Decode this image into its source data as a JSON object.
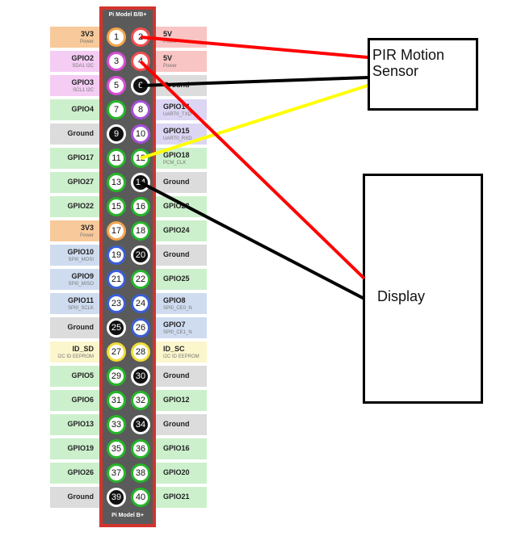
{
  "header": {
    "title": "Pi Model B/B+"
  },
  "footer": {
    "title": "Pi Model B+"
  },
  "colors": {
    "power": "#f4a44d",
    "power5v": "#f24e4e",
    "ground": "#111111",
    "gpio": "#27b52a",
    "i2c": "#d64fd6",
    "uart": "#a64fd6",
    "spi": "#3a5fd6",
    "eeprom": "#f0dd3a"
  },
  "rows": [
    {
      "left": {
        "pin": "1",
        "type": "power",
        "label": "3V3",
        "sub": "Power"
      },
      "right": {
        "pin": "2",
        "type": "power5v",
        "label": "5V",
        "sub": "Power"
      }
    },
    {
      "left": {
        "pin": "3",
        "type": "i2c",
        "label": "GPIO2",
        "sub": "SDA1 I2C"
      },
      "right": {
        "pin": "4",
        "type": "power5v",
        "label": "5V",
        "sub": "Power"
      }
    },
    {
      "left": {
        "pin": "5",
        "type": "i2c",
        "label": "GPIO3",
        "sub": "SCL1 I2C"
      },
      "right": {
        "pin": "6",
        "type": "ground",
        "label": "Ground",
        "sub": ""
      }
    },
    {
      "left": {
        "pin": "7",
        "type": "gpio",
        "label": "GPIO4",
        "sub": ""
      },
      "right": {
        "pin": "8",
        "type": "uart",
        "label": "GPIO14",
        "sub": "UART0_TXD"
      }
    },
    {
      "left": {
        "pin": "9",
        "type": "ground",
        "label": "Ground",
        "sub": ""
      },
      "right": {
        "pin": "10",
        "type": "uart",
        "label": "GPIO15",
        "sub": "UART0_RXD"
      }
    },
    {
      "left": {
        "pin": "11",
        "type": "gpio",
        "label": "GPIO17",
        "sub": ""
      },
      "right": {
        "pin": "12",
        "type": "gpio",
        "label": "GPIO18",
        "sub": "PCM_CLK"
      }
    },
    {
      "left": {
        "pin": "13",
        "type": "gpio",
        "label": "GPIO27",
        "sub": ""
      },
      "right": {
        "pin": "14",
        "type": "ground",
        "label": "Ground",
        "sub": ""
      }
    },
    {
      "left": {
        "pin": "15",
        "type": "gpio",
        "label": "GPIO22",
        "sub": ""
      },
      "right": {
        "pin": "16",
        "type": "gpio",
        "label": "GPIO23",
        "sub": ""
      }
    },
    {
      "left": {
        "pin": "17",
        "type": "power",
        "label": "3V3",
        "sub": "Power"
      },
      "right": {
        "pin": "18",
        "type": "gpio",
        "label": "GPIO24",
        "sub": ""
      }
    },
    {
      "left": {
        "pin": "19",
        "type": "spi",
        "label": "GPIO10",
        "sub": "SPI0_MOSI"
      },
      "right": {
        "pin": "20",
        "type": "ground",
        "label": "Ground",
        "sub": ""
      }
    },
    {
      "left": {
        "pin": "21",
        "type": "spi",
        "label": "GPIO9",
        "sub": "SPI0_MISO"
      },
      "right": {
        "pin": "22",
        "type": "gpio",
        "label": "GPIO25",
        "sub": ""
      }
    },
    {
      "left": {
        "pin": "23",
        "type": "spi",
        "label": "GPIO11",
        "sub": "SPI0_SCLK"
      },
      "right": {
        "pin": "24",
        "type": "spi",
        "label": "GPIO8",
        "sub": "SPI0_CE0_N"
      }
    },
    {
      "left": {
        "pin": "25",
        "type": "ground",
        "label": "Ground",
        "sub": ""
      },
      "right": {
        "pin": "26",
        "type": "spi",
        "label": "GPIO7",
        "sub": "SPI0_CE1_N"
      }
    },
    {
      "left": {
        "pin": "27",
        "type": "eeprom",
        "label": "ID_SD",
        "sub": "I2C ID EEPROM"
      },
      "right": {
        "pin": "28",
        "type": "eeprom",
        "label": "ID_SC",
        "sub": "I2C ID EEPROM"
      }
    },
    {
      "left": {
        "pin": "29",
        "type": "gpio",
        "label": "GPIO5",
        "sub": ""
      },
      "right": {
        "pin": "30",
        "type": "ground",
        "label": "Ground",
        "sub": ""
      }
    },
    {
      "left": {
        "pin": "31",
        "type": "gpio",
        "label": "GPIO6",
        "sub": ""
      },
      "right": {
        "pin": "32",
        "type": "gpio",
        "label": "GPIO12",
        "sub": ""
      }
    },
    {
      "left": {
        "pin": "33",
        "type": "gpio",
        "label": "GPIO13",
        "sub": ""
      },
      "right": {
        "pin": "34",
        "type": "ground",
        "label": "Ground",
        "sub": ""
      }
    },
    {
      "left": {
        "pin": "35",
        "type": "gpio",
        "label": "GPIO19",
        "sub": ""
      },
      "right": {
        "pin": "36",
        "type": "gpio",
        "label": "GPIO16",
        "sub": ""
      }
    },
    {
      "left": {
        "pin": "37",
        "type": "gpio",
        "label": "GPIO26",
        "sub": ""
      },
      "right": {
        "pin": "38",
        "type": "gpio",
        "label": "GPIO20",
        "sub": ""
      }
    },
    {
      "left": {
        "pin": "39",
        "type": "ground",
        "label": "Ground",
        "sub": ""
      },
      "right": {
        "pin": "40",
        "type": "gpio",
        "label": "GPIO21",
        "sub": ""
      }
    }
  ],
  "devices": {
    "pir": {
      "label": "PIR Motion\nSensor"
    },
    "display": {
      "label": "Display"
    }
  },
  "wires": [
    {
      "from_pin": "2",
      "to": "pir",
      "color": "#ff0000"
    },
    {
      "from_pin": "6",
      "to": "pir",
      "color": "#000000"
    },
    {
      "from_pin": "12",
      "to": "pir",
      "color": "#ffff00"
    },
    {
      "from_pin": "4",
      "to": "display",
      "color": "#ff0000"
    },
    {
      "from_pin": "14",
      "to": "display",
      "color": "#000000"
    }
  ]
}
